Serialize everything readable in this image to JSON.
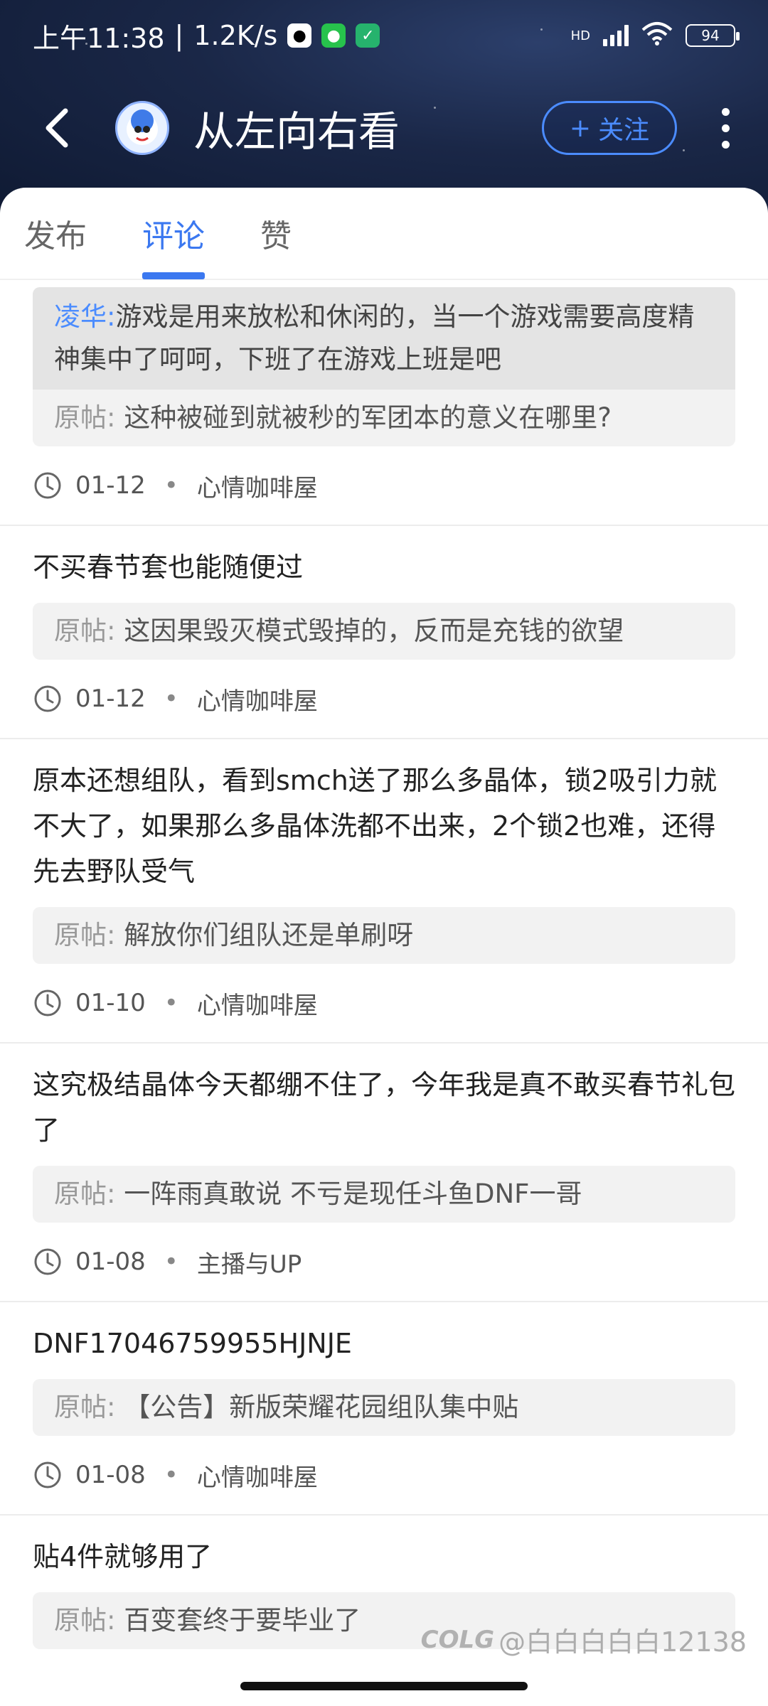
{
  "status_bar": {
    "time": "上午11:38",
    "speed": "1.2K/s",
    "battery": "94",
    "network": "HD"
  },
  "header": {
    "title": "从左向右看",
    "follow_label": "关注",
    "follow_plus": "+"
  },
  "tabs": [
    {
      "label": "发布",
      "active": false
    },
    {
      "label": "评论",
      "active": true
    },
    {
      "label": "赞",
      "active": false
    }
  ],
  "items": [
    {
      "reply_user": "凌华:",
      "reply_text": "游戏是用来放松和休闲的，当一个游戏需要高度精神集中了呵呵，下班了在游戏上班是吧",
      "orig_label": "原帖:",
      "orig_text": "这种被碰到就被秒的军团本的意义在哪里?",
      "date": "01-12",
      "board": "心情咖啡屋"
    },
    {
      "comment": "不买春节套也能随便过",
      "orig_label": "原帖:",
      "orig_text": "这因果毁灭模式毁掉的，反而是充钱的欲望",
      "date": "01-12",
      "board": "心情咖啡屋"
    },
    {
      "comment": "原本还想组队，看到smch送了那么多晶体，锁2吸引力就不大了，如果那么多晶体洗都不出来，2个锁2也难，还得先去野队受气",
      "orig_label": "原帖:",
      "orig_text": "解放你们组队还是单刷呀",
      "date": "01-10",
      "board": "心情咖啡屋"
    },
    {
      "comment": "这究极结晶体今天都绷不住了，今年我是真不敢买春节礼包了",
      "orig_label": "原帖:",
      "orig_text": "一阵雨真敢说  不亏是现任斗鱼DNF一哥",
      "date": "01-08",
      "board": "主播与UP"
    },
    {
      "comment": "DNF17046759955HJNJE",
      "orig_label": "原帖:",
      "orig_text": "【公告】新版荣耀花园组队集中贴",
      "date": "01-08",
      "board": "心情咖啡屋"
    },
    {
      "comment": "贴4件就够用了",
      "orig_label": "原帖:",
      "orig_text": "百变套终于要毕业了"
    }
  ],
  "watermark": {
    "logo": "COLG",
    "text": "@白白白白白12138"
  }
}
